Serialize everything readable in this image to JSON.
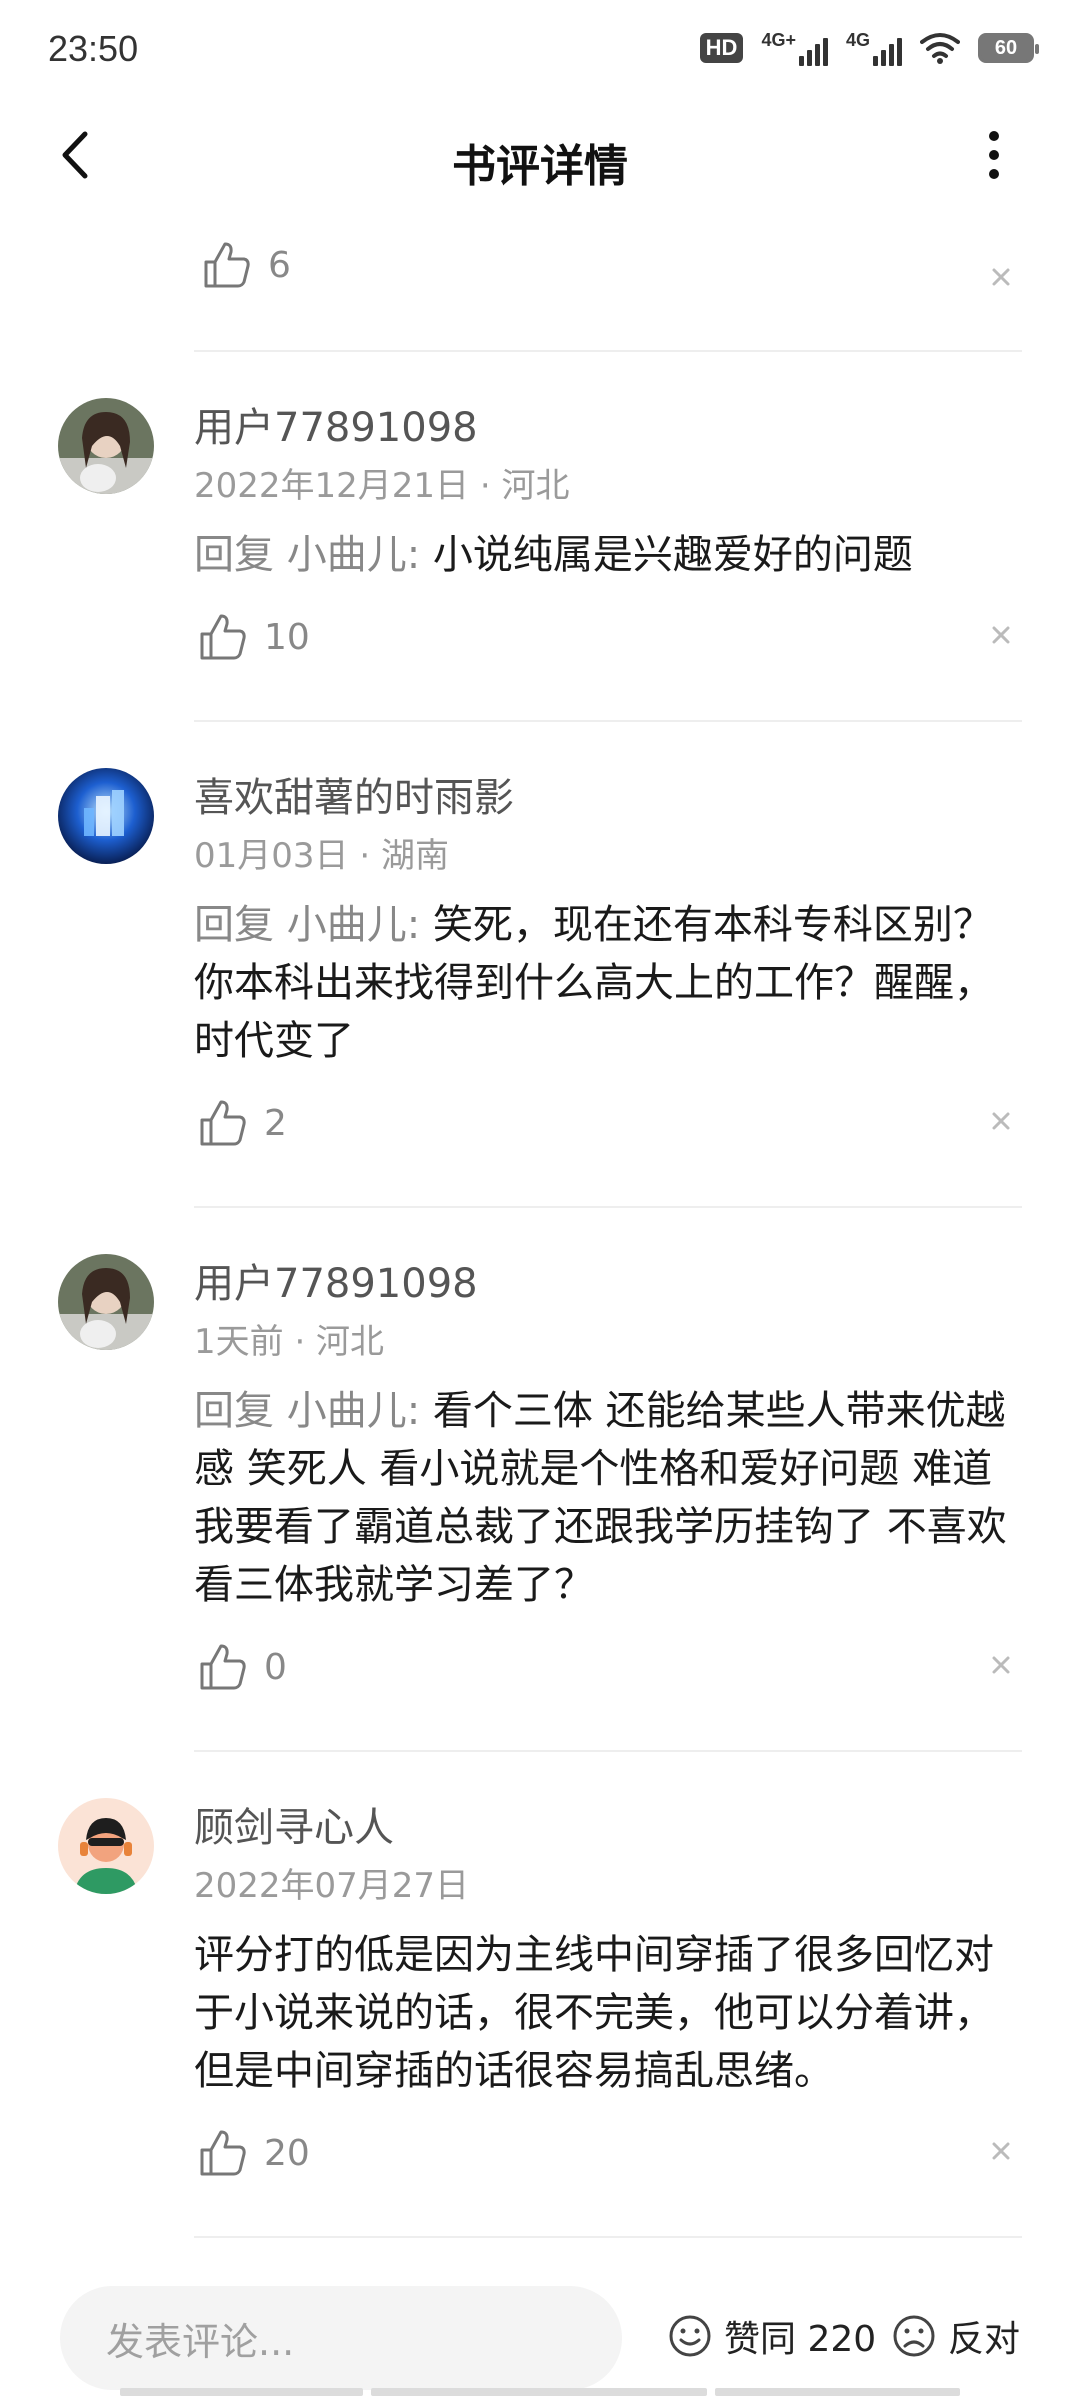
{
  "status_bar": {
    "time": "23:50",
    "hd_label": "HD",
    "net1_label": "4G+",
    "net2_label": "4G",
    "battery": "60"
  },
  "header": {
    "title": "书评详情",
    "back_icon": "chevron-left-icon",
    "more_icon": "more-vertical-icon"
  },
  "first_row": {
    "like_count": "6"
  },
  "comments": [
    {
      "name": "用户77891098",
      "meta": "2022年12月21日 · 河北",
      "reply_prefix": "回复 小曲儿: ",
      "text": "小说纯属是兴趣爱好的问题",
      "like_count": "10"
    },
    {
      "name": "喜欢甜薯的时雨影",
      "meta": "01月03日 · 湖南",
      "reply_prefix": "回复 小曲儿: ",
      "text": "笑死，现在还有本科专科区别？你本科出来找得到什么高大上的工作？醒醒，时代变了",
      "like_count": "2"
    },
    {
      "name": "用户77891098",
      "meta": "1天前 · 河北",
      "reply_prefix": "回复 小曲儿: ",
      "text": "看个三体 还能给某些人带来优越感 笑死人 看小说就是个性格和爱好问题 难道我要看了霸道总裁了还跟我学历挂钩了 不喜欢看三体我就学习差了？",
      "like_count": "0"
    },
    {
      "name": "顾剑寻心人",
      "meta": "2022年07月27日",
      "reply_prefix": "",
      "text": "评分打的低是因为主线中间穿插了很多回忆对于小说来说的话，很不完美，他可以分着讲，但是中间穿插的话很容易搞乱思绪。",
      "like_count": "20"
    }
  ],
  "bottom_bar": {
    "input_placeholder": "发表评论...",
    "agree_label": "赞同 220",
    "disagree_label": "反对"
  },
  "colors": {
    "text_primary": "#1a1a1a",
    "text_secondary": "#888888",
    "divider": "#eeeeee"
  }
}
